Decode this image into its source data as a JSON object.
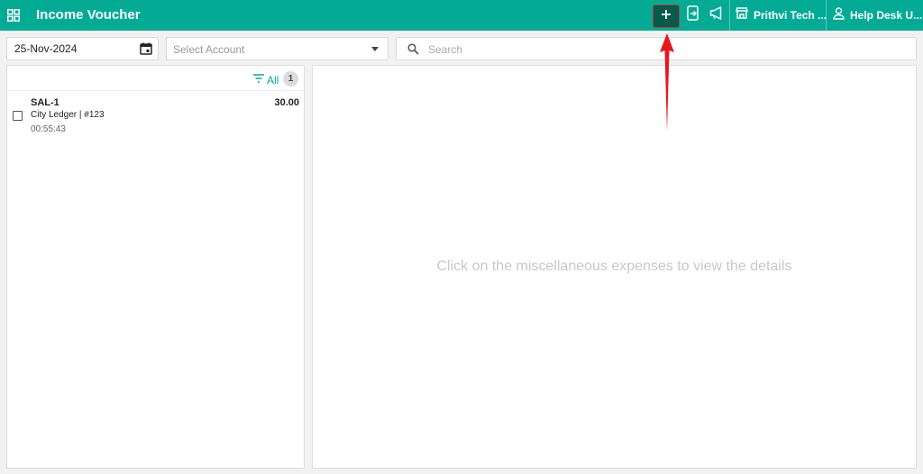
{
  "header": {
    "title": "Income Voucher",
    "menu_icon": "apps-grid-icon",
    "actions": [
      {
        "name": "add",
        "icon": "plus-icon"
      },
      {
        "name": "mobile",
        "icon": "phone-export-icon"
      },
      {
        "name": "announcements",
        "icon": "megaphone-icon"
      }
    ],
    "store_label": "Prithvi Tech ...",
    "user_label": "Help Desk U..."
  },
  "filters": {
    "date": "25-Nov-2024",
    "account_placeholder": "Select Account",
    "search_placeholder": "Search"
  },
  "list": {
    "filter_label": "All",
    "count": "1",
    "items": [
      {
        "title": "SAL-1",
        "amount": "30.00",
        "subtitle": "City Ledger | #123",
        "time": "00:55:43"
      }
    ]
  },
  "detail": {
    "empty_message": "Click on the miscellaneous expenses to view the details"
  },
  "colors": {
    "accent": "#03ab94",
    "add_button_bg": "#045a4c",
    "arrow": "#e8161b"
  }
}
